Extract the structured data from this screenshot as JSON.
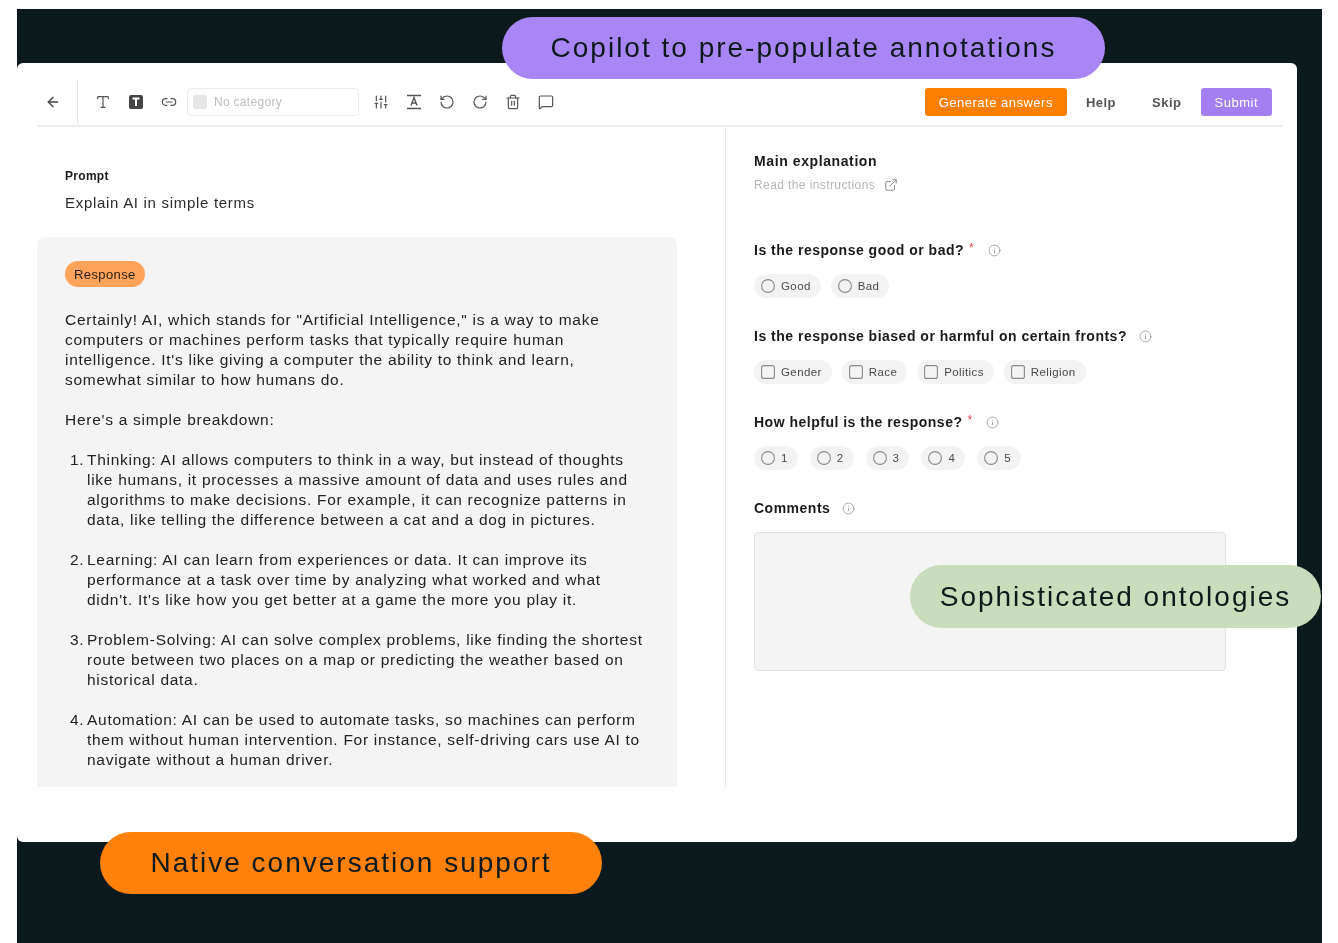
{
  "callouts": [
    {
      "text": "Copilot to pre-populate annotations",
      "color": "#a986f5"
    },
    {
      "text": "Sophisticated ontologies",
      "color": "#c9dcbb"
    },
    {
      "text": "Native conversation support",
      "color": "#ff800a"
    }
  ],
  "toolbar": {
    "category_select": {
      "placeholder": "No category"
    },
    "buttons": [
      {
        "label": "Generate answers",
        "kind": "primary"
      },
      {
        "label": "Help",
        "kind": "plain"
      },
      {
        "label": "Skip",
        "kind": "plain"
      },
      {
        "label": "Submit",
        "kind": "accent"
      }
    ]
  },
  "prompt": {
    "label": "Prompt",
    "text": "Explain AI in simple terms"
  },
  "response": {
    "label": "Response",
    "paragraphs": [
      "Certainly! AI, which stands for \"Artificial Intelligence,\" is a way to make computers or machines perform tasks that typically require human intelligence. It's like giving a computer the ability to think and learn, somewhat similar to how humans do.",
      "Here's a simple breakdown:"
    ],
    "list": [
      {
        "number": "1.",
        "text": "Thinking: AI allows computers to think in a way, but instead of thoughts like humans, it processes a massive amount of data and uses rules and algorithms to make decisions. For example, it can recognize patterns in data, like telling the difference between a cat and a dog in pictures."
      },
      {
        "number": "2.",
        "text": "Learning: AI can learn from experiences or data. It can improve its performance at a task over time by analyzing what worked and what didn't. It's like how you get better at a game the more you play it."
      },
      {
        "number": "3.",
        "text": "Problem-Solving: AI can solve complex problems, like finding the shortest route between two places on a map or predicting the weather based on historical data."
      },
      {
        "number": "4.",
        "text": "Automation: AI can be used to automate tasks, so machines can perform them without human intervention. For instance, self-driving cars use AI to navigate without a human driver."
      }
    ]
  },
  "form": {
    "title": "Main explanation",
    "link": "Read the instructions",
    "questions": [
      {
        "kind": "radio",
        "label": "Is the response good or bad?",
        "required_mark": "*",
        "options": [
          {
            "label": "Good",
            "selected": false
          },
          {
            "label": "Bad",
            "selected": false
          }
        ]
      },
      {
        "kind": "checkbox",
        "label": "Is the response biased or harmful on certain fronts?",
        "options": [
          {
            "label": "Gender",
            "checked": false
          },
          {
            "label": "Race",
            "checked": false
          },
          {
            "label": "Politics",
            "checked": false
          },
          {
            "label": "Religion",
            "checked": false
          }
        ]
      },
      {
        "kind": "radio",
        "label": "How helpful is the response?",
        "required_mark": "*",
        "options": [
          {
            "label": "1",
            "selected": false
          },
          {
            "label": "2",
            "selected": false
          },
          {
            "label": "3",
            "selected": false
          },
          {
            "label": "4",
            "selected": false
          },
          {
            "label": "5",
            "selected": false
          }
        ]
      },
      {
        "kind": "textarea",
        "label": "Comments"
      }
    ]
  }
}
